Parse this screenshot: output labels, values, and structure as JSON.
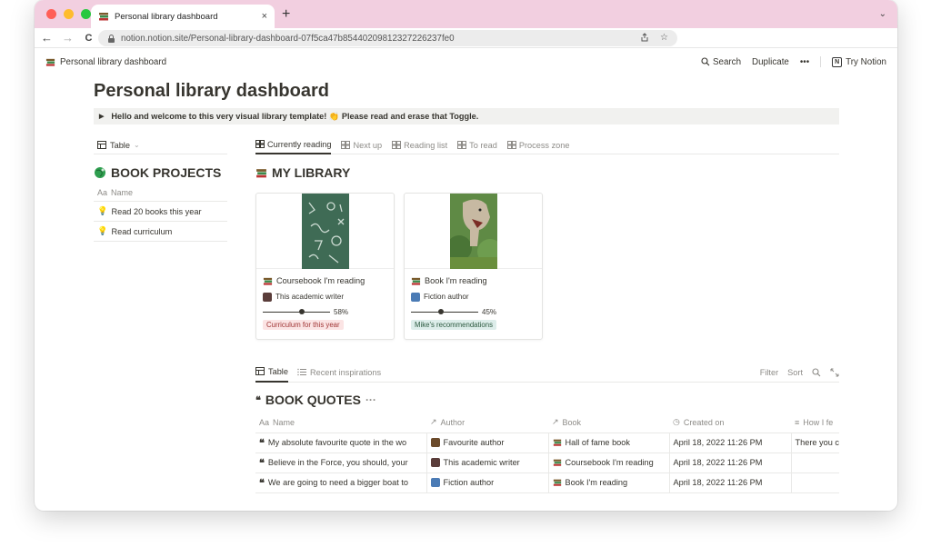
{
  "browser": {
    "tab_title": "Personal library dashboard",
    "tab_close": "×",
    "new_tab": "+",
    "tabs_menu": "⌄",
    "back": "←",
    "forward": "→",
    "reload": "C",
    "url": "notion.notion.site/Personal-library-dashboard-07f5ca47b85440209812327226237fe0",
    "colors": {
      "tabbar": "#f2cfe0",
      "close": "#ff5f57",
      "minimize": "#febc2e",
      "zoom": "#28c840"
    }
  },
  "topbar": {
    "breadcrumb": "Personal library dashboard",
    "search": "Search",
    "duplicate": "Duplicate",
    "more": "•••",
    "try_notion": "Try Notion",
    "notion_letter": "N"
  },
  "page": {
    "title": "Personal library dashboard",
    "toggle_text": "Hello and welcome to this very visual library template! 👏 Please read and erase that Toggle."
  },
  "projects": {
    "view": "Table",
    "view_chevron": "⌄",
    "title": "BOOK PROJECTS",
    "column": "Name",
    "column_prefix": "Aa",
    "rows": [
      {
        "icon": "💡",
        "name": "Read 20 books this year"
      },
      {
        "icon": "💡",
        "name": "Read curriculum"
      }
    ]
  },
  "library": {
    "tabs": [
      {
        "label": "Currently reading"
      },
      {
        "label": "Next up"
      },
      {
        "label": "Reading list"
      },
      {
        "label": "To read"
      },
      {
        "label": "Process zone"
      }
    ],
    "title": "MY LIBRARY",
    "cards": [
      {
        "title": "Coursebook I'm reading",
        "author": "This academic writer",
        "progress_label": "58%",
        "progress": 0.58,
        "tag": "Curriculum for this year",
        "tag_bg": "#fbe4e4",
        "tag_fg": "#a03535"
      },
      {
        "title": "Book I'm reading",
        "author": "Fiction author",
        "progress_label": "45%",
        "progress": 0.45,
        "tag": "Mike's recommendations",
        "tag_bg": "#ddedea",
        "tag_fg": "#2b593f"
      }
    ]
  },
  "quotes": {
    "tabs": [
      {
        "label": "Table"
      },
      {
        "label": "Recent inspirations"
      }
    ],
    "filter": "Filter",
    "sort": "Sort",
    "title": "BOOK QUOTES",
    "title_more": "···",
    "columns": [
      "Name",
      "Author",
      "Book",
      "Created on",
      "How I fe"
    ],
    "column_prefixes": [
      "Aa",
      "↗",
      "↗",
      "◷",
      "≡"
    ],
    "rows": [
      {
        "name": "My absolute favourite quote in the wo",
        "author": "Favourite author",
        "book": "Hall of fame book",
        "created": "April 18, 2022 11:26 PM",
        "feel": "There you c"
      },
      {
        "name": "Believe in the Force, you should, your",
        "author": "This academic writer",
        "book": "Coursebook I'm reading",
        "created": "April 18, 2022 11:26 PM",
        "feel": ""
      },
      {
        "name": "We are going to need a bigger boat to",
        "author": "Fiction author",
        "book": "Book I'm reading",
        "created": "April 18, 2022 11:26 PM",
        "feel": ""
      }
    ]
  }
}
